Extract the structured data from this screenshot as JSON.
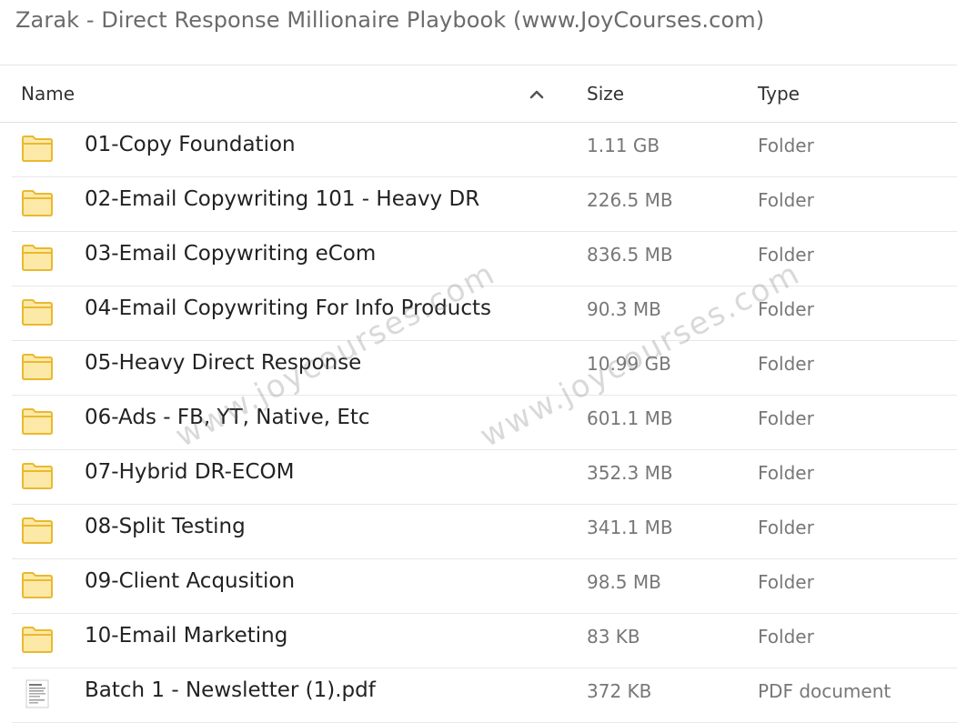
{
  "page": {
    "title": "Zarak - Direct Response Millionaire Playbook (www.JoyCourses.com)"
  },
  "columns": {
    "name": "Name",
    "size": "Size",
    "type": "Type",
    "sort_icon": "chevron-up-icon"
  },
  "files": [
    {
      "name": "01-Copy Foundation",
      "size": "1.11 GB",
      "type": "Folder",
      "icon": "folder-icon"
    },
    {
      "name": "02-Email Copywriting 101 - Heavy DR",
      "size": "226.5 MB",
      "type": "Folder",
      "icon": "folder-icon"
    },
    {
      "name": "03-Email Copywriting eCom",
      "size": "836.5 MB",
      "type": "Folder",
      "icon": "folder-icon"
    },
    {
      "name": "04-Email Copywriting For Info Products",
      "size": "90.3 MB",
      "type": "Folder",
      "icon": "folder-icon"
    },
    {
      "name": "05-Heavy Direct Response",
      "size": "10.99 GB",
      "type": "Folder",
      "icon": "folder-icon"
    },
    {
      "name": "06-Ads - FB, YT, Native, Etc",
      "size": "601.1 MB",
      "type": "Folder",
      "icon": "folder-icon"
    },
    {
      "name": "07-Hybrid DR-ECOM",
      "size": "352.3 MB",
      "type": "Folder",
      "icon": "folder-icon"
    },
    {
      "name": "08-Split Testing",
      "size": "341.1 MB",
      "type": "Folder",
      "icon": "folder-icon"
    },
    {
      "name": "09-Client Acqusition",
      "size": "98.5 MB",
      "type": "Folder",
      "icon": "folder-icon"
    },
    {
      "name": "10-Email Marketing",
      "size": "83 KB",
      "type": "Folder",
      "icon": "folder-icon"
    },
    {
      "name": "Batch 1 - Newsletter (1).pdf",
      "size": "372 KB",
      "type": "PDF document",
      "icon": "pdf-thumbnail-icon"
    }
  ],
  "watermarks": [
    "www.joycourses.com",
    "www.joycourses.com"
  ],
  "colors": {
    "folder_fill": "#fde9a7",
    "folder_stroke": "#e9b92f",
    "muted_text": "#777777"
  }
}
